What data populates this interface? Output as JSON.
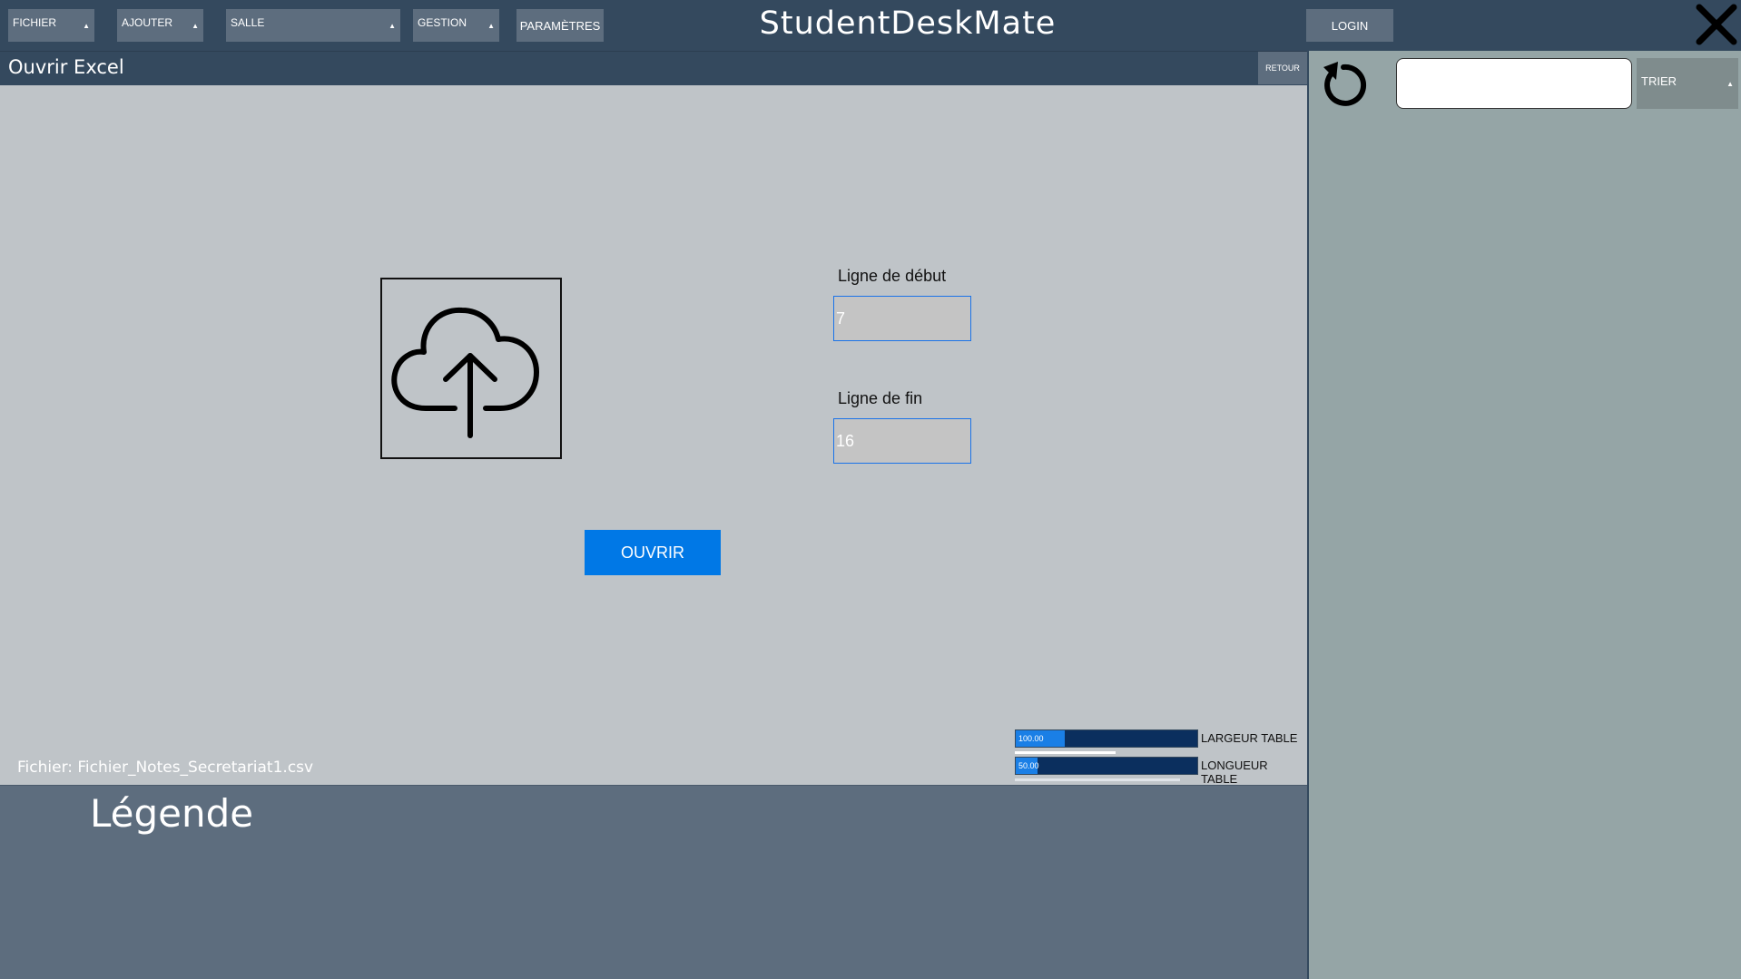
{
  "app": {
    "title": "StudentDeskMate"
  },
  "menu": {
    "fichier": "FICHIER",
    "ajouter": "AJOUTER",
    "salle": "SALLE",
    "gestion": "GESTION",
    "parametres": "PARAMÈTRES",
    "login": "LOGIN",
    "caret": "▲"
  },
  "subheader": {
    "title": "Ouvrir Excel",
    "back": "RETOUR"
  },
  "form": {
    "start_label": "Ligne de début",
    "start_value": "7",
    "end_label": "Ligne de fin",
    "end_value": "16",
    "open_button": "OUVRIR"
  },
  "file": {
    "label": "Fichier: Fichier_Notes_Secretariat1.csv"
  },
  "sliders": {
    "width": {
      "name": "LARGEUR TABLE",
      "value": "100.00",
      "fill": 0.27,
      "sub_fill": 0.55
    },
    "length": {
      "name": "LONGUEUR TABLE",
      "value": "50.00",
      "fill": 0.12,
      "sub_fill": 0.9
    }
  },
  "legend": {
    "title": "Légende"
  },
  "sidebar": {
    "search_value": "",
    "sort_label": "TRIER"
  },
  "icons": {
    "upload": "cloud-upload-icon",
    "undo": "undo-icon",
    "close": "close-icon"
  },
  "colors": {
    "header": "#34495e",
    "button": "#5d6d7e",
    "accent": "#0078e6",
    "sidebar": "#95a5a6"
  }
}
